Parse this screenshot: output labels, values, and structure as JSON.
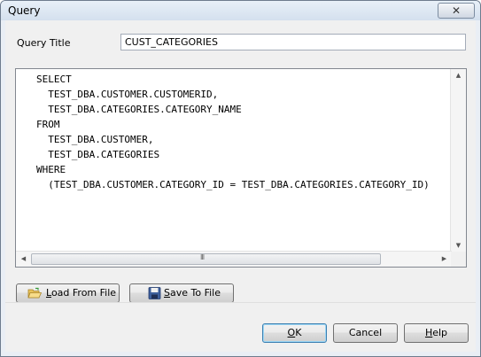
{
  "window": {
    "title": "Query",
    "close_glyph": "✕"
  },
  "query_title": {
    "label": "Query Title",
    "value": "CUST_CATEGORIES"
  },
  "sql_lines": [
    "SELECT",
    "  TEST_DBA.CUSTOMER.CUSTOMERID,",
    "  TEST_DBA.CATEGORIES.CATEGORY_NAME",
    "FROM",
    "  TEST_DBA.CUSTOMER,",
    "  TEST_DBA.CATEGORIES",
    "WHERE",
    "  (TEST_DBA.CUSTOMER.CATEGORY_ID = TEST_DBA.CATEGORIES.CATEGORY_ID)"
  ],
  "scroll": {
    "up": "▲",
    "down": "▼",
    "left": "◀",
    "right": "▶",
    "grip": "III"
  },
  "buttons": {
    "load": {
      "mnemonic": "L",
      "rest": "oad From File"
    },
    "save": {
      "mnemonic": "S",
      "rest": "ave To File"
    },
    "ok": {
      "mnemonic": "O",
      "rest": "K"
    },
    "cancel": {
      "label": "Cancel"
    },
    "help": {
      "mnemonic": "H",
      "rest": "elp"
    }
  },
  "icons": {
    "load": "folder-open-icon",
    "save": "floppy-disk-icon"
  }
}
